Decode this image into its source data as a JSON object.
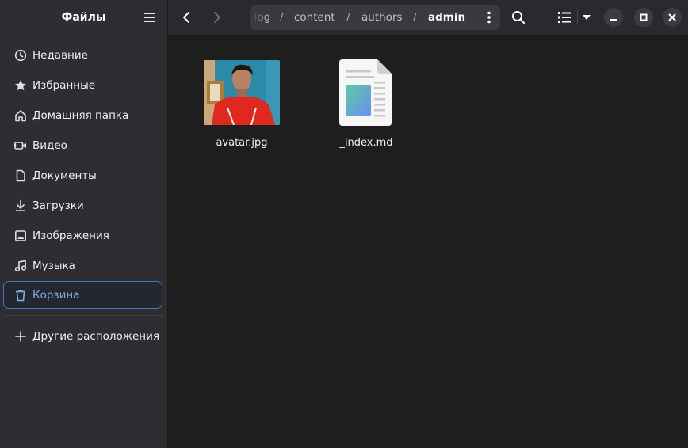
{
  "sidebar": {
    "title": "Файлы",
    "items": [
      {
        "label": "Недавние",
        "icon": "clock-icon"
      },
      {
        "label": "Избранные",
        "icon": "star-icon"
      },
      {
        "label": "Домашняя папка",
        "icon": "home-icon"
      },
      {
        "label": "Видео",
        "icon": "video-icon"
      },
      {
        "label": "Документы",
        "icon": "document-icon"
      },
      {
        "label": "Загрузки",
        "icon": "download-icon"
      },
      {
        "label": "Изображения",
        "icon": "image-icon"
      },
      {
        "label": "Музыка",
        "icon": "music-icon"
      },
      {
        "label": "Корзина",
        "icon": "trash-icon",
        "active": true
      }
    ],
    "other_locations": {
      "label": "Другие расположения",
      "icon": "plus-icon"
    }
  },
  "header": {
    "path": [
      {
        "label": "blog"
      },
      {
        "label": "content"
      },
      {
        "label": "authors"
      },
      {
        "label": "admin",
        "current": true
      }
    ],
    "separator": "/"
  },
  "files": [
    {
      "name": "avatar.jpg",
      "type": "image"
    },
    {
      "name": "_index.md",
      "type": "text"
    }
  ],
  "colors": {
    "accent": "#78aeed",
    "sidebar_bg": "#2e2e32",
    "content_bg": "#1e1e1e",
    "header_bg": "#2a2a2e"
  }
}
